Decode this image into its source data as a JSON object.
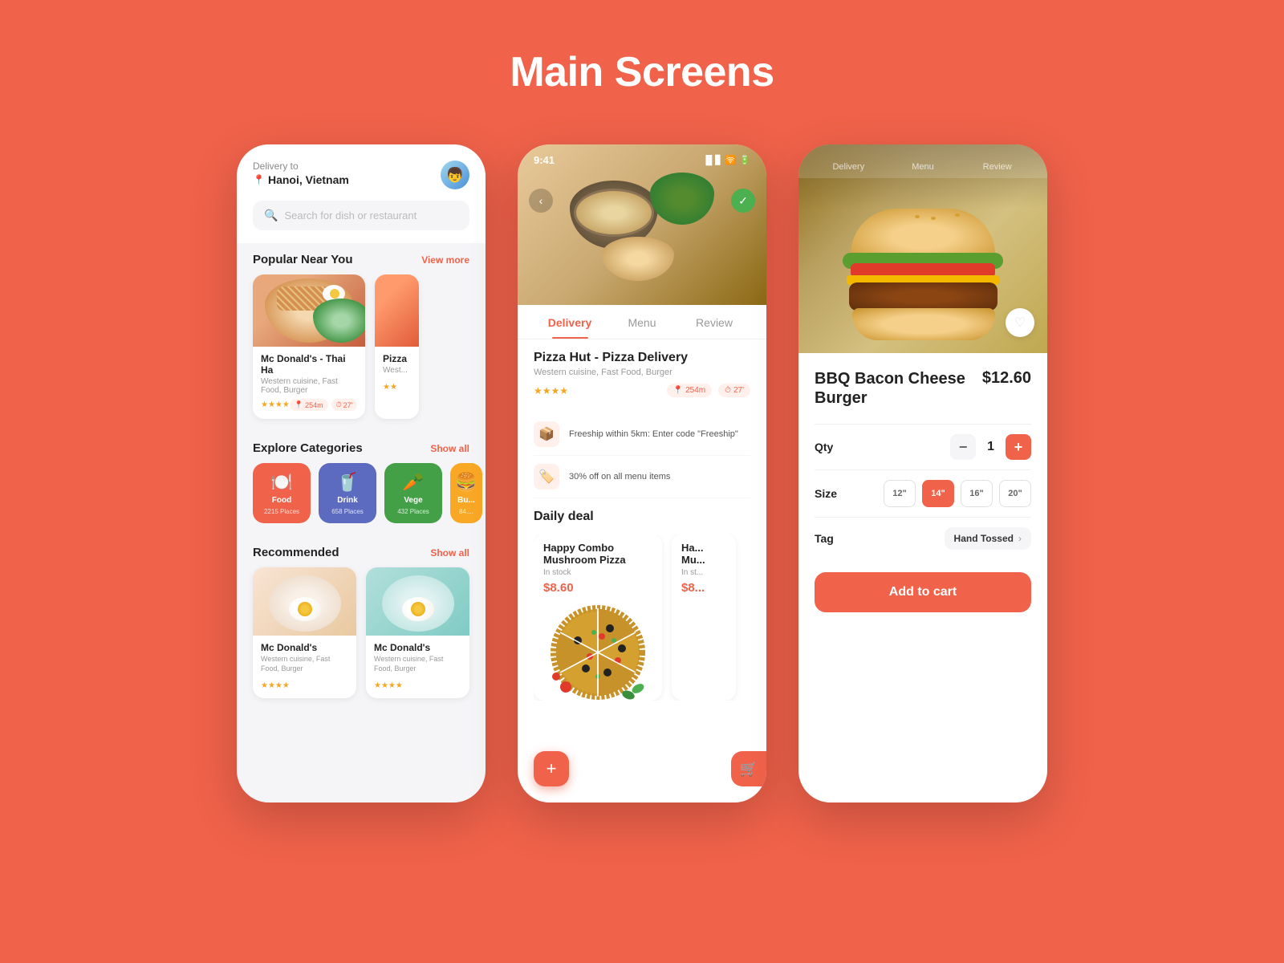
{
  "page": {
    "title": "Main Screens",
    "bg_color": "#F0624A"
  },
  "phone1": {
    "header": {
      "delivery_label": "Delivery to",
      "location": "Hanoi, Vietnam"
    },
    "search": {
      "placeholder": "Search for dish or restaurant"
    },
    "popular": {
      "title": "Popular Near You",
      "view_more": "View more",
      "items": [
        {
          "name": "Mc Donald's - Thai Ha",
          "sub": "Western cuisine, Fast Food, Burger",
          "rating": "★★★★",
          "distance": "254m",
          "time": "27'"
        },
        {
          "name": "Pizza",
          "sub": "West...",
          "rating": "★★"
        }
      ]
    },
    "categories": {
      "title": "Explore Categories",
      "show_all": "Show all",
      "items": [
        {
          "name": "Food",
          "count": "2215 Places",
          "color": "#F0624A"
        },
        {
          "name": "Drink",
          "count": "658 Places",
          "color": "#5c6bc0"
        },
        {
          "name": "Vege",
          "count": "432 Places",
          "color": "#43a047"
        },
        {
          "name": "Bu...",
          "count": "84....",
          "color": "#f9a825"
        }
      ]
    },
    "recommended": {
      "title": "Recommended",
      "show_all": "Show all",
      "items": [
        {
          "name": "Mc Donald's",
          "sub": "Western cuisine, Fast Food, Burger",
          "rating": "★★★★"
        },
        {
          "name": "Mc Donald's",
          "sub": "Western cuisine, Fast Food, Burger",
          "rating": "★★★★"
        }
      ]
    }
  },
  "phone2": {
    "status_bar": {
      "time": "9:41",
      "icons": "▐ ▌ ▊ 🔋"
    },
    "tabs": [
      {
        "label": "Delivery",
        "active": true
      },
      {
        "label": "Menu",
        "active": false
      },
      {
        "label": "Review",
        "active": false
      }
    ],
    "restaurant": {
      "name": "Pizza Hut - Pizza Delivery",
      "sub": "Western cuisine, Fast Food, Burger",
      "rating": "★★★★",
      "distance": "254m",
      "time": "27'"
    },
    "promos": [
      {
        "icon": "📦",
        "text": "Freeship within 5km: Enter code \"Freeship\""
      },
      {
        "icon": "🏷️",
        "text": "30% off on all menu items"
      }
    ],
    "daily_deal": {
      "title": "Daily deal",
      "items": [
        {
          "name": "Happy Combo Mushroom Pizza",
          "stock": "In stock",
          "price": "$8.60"
        },
        {
          "name": "Ha... Mu...",
          "stock": "In st...",
          "price": "$8..."
        }
      ]
    }
  },
  "phone3": {
    "tabs": [
      {
        "label": "Delivery"
      },
      {
        "label": "Menu"
      },
      {
        "label": "Review"
      }
    ],
    "product": {
      "name": "BBQ Bacon Cheese Burger",
      "price": "$12.60"
    },
    "qty": {
      "label": "Qty",
      "value": "1",
      "minus": "−",
      "plus": "+"
    },
    "size": {
      "label": "Size",
      "options": [
        {
          "label": "12\"",
          "active": false
        },
        {
          "label": "14\"",
          "active": true
        },
        {
          "label": "16\"",
          "active": false
        },
        {
          "label": "20\"",
          "active": false
        }
      ]
    },
    "tag": {
      "label": "Tag",
      "value": "Hand Tossed",
      "chevron": "›"
    },
    "add_to_cart": "Add to cart"
  }
}
